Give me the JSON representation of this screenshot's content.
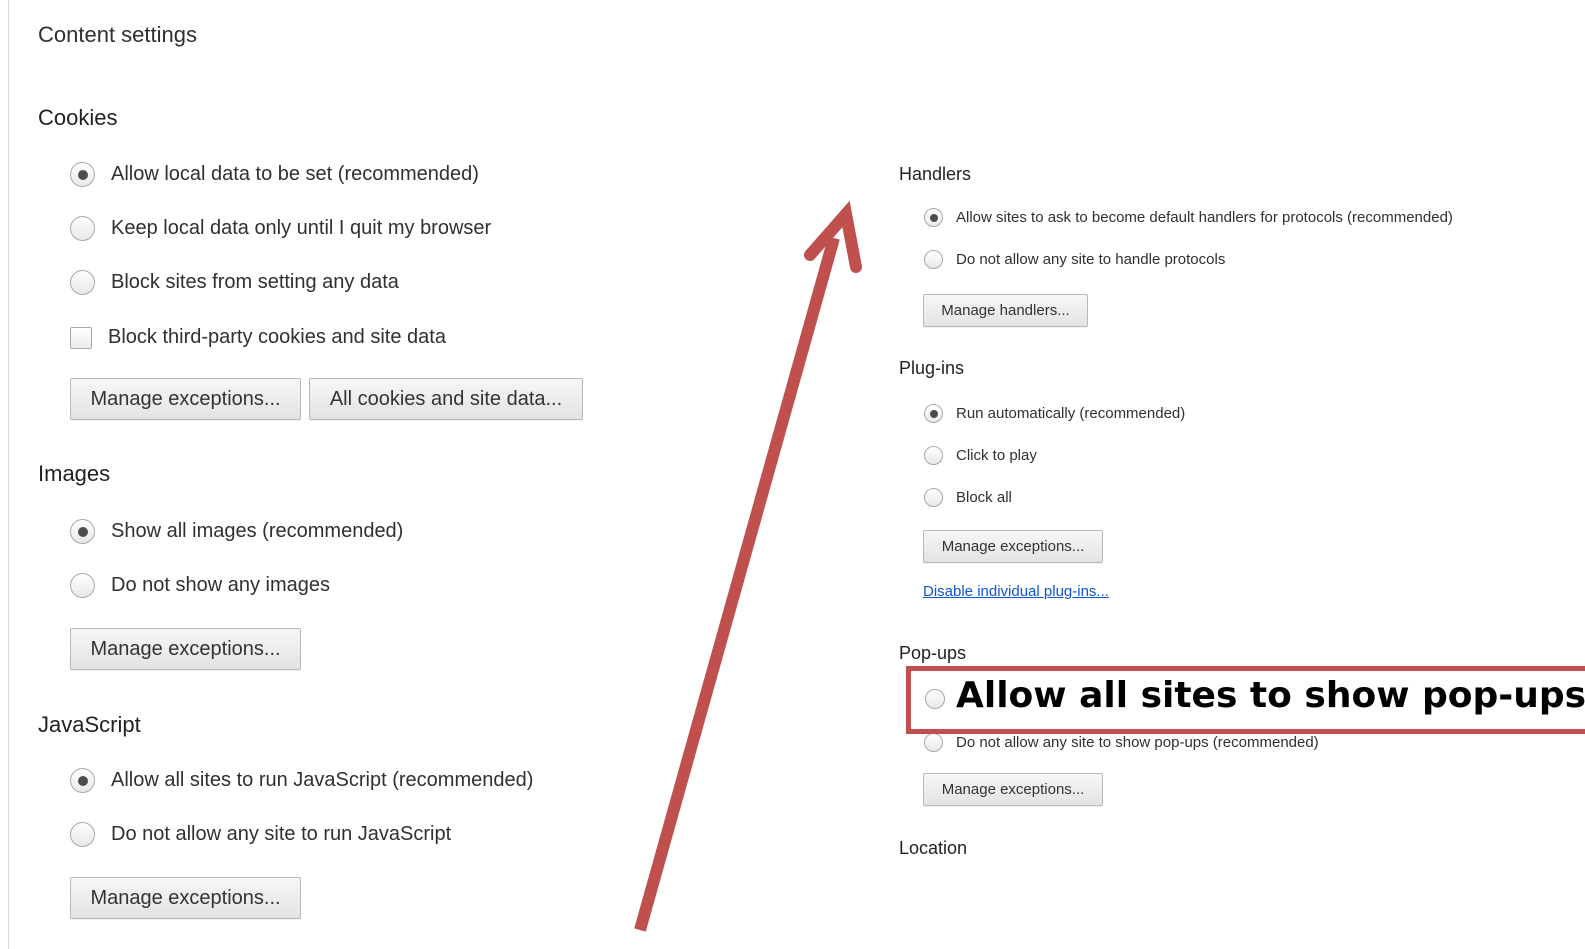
{
  "page": {
    "title": "Content settings"
  },
  "cookies": {
    "title": "Cookies",
    "options": [
      {
        "label": "Allow local data to be set (recommended)",
        "selected": true
      },
      {
        "label": "Keep local data only until I quit my browser",
        "selected": false
      },
      {
        "label": "Block sites from setting any data",
        "selected": false
      }
    ],
    "checkbox": {
      "label": "Block third-party cookies and site data",
      "checked": false
    },
    "buttons": {
      "manage_exceptions": "Manage exceptions...",
      "all_cookies": "All cookies and site data..."
    }
  },
  "images": {
    "title": "Images",
    "options": [
      {
        "label": "Show all images (recommended)",
        "selected": true
      },
      {
        "label": "Do not show any images",
        "selected": false
      }
    ],
    "buttons": {
      "manage_exceptions": "Manage exceptions..."
    }
  },
  "javascript": {
    "title": "JavaScript",
    "options": [
      {
        "label": "Allow all sites to run JavaScript (recommended)",
        "selected": true
      },
      {
        "label": "Do not allow any site to run JavaScript",
        "selected": false
      }
    ],
    "buttons": {
      "manage_exceptions": "Manage exceptions..."
    }
  },
  "handlers": {
    "title": "Handlers",
    "options": [
      {
        "label": "Allow sites to ask to become default handlers for protocols (recommended)",
        "selected": true
      },
      {
        "label": "Do not allow any site to handle protocols",
        "selected": false
      }
    ],
    "buttons": {
      "manage_handlers": "Manage handlers..."
    }
  },
  "plugins": {
    "title": "Plug-ins",
    "options": [
      {
        "label": "Run automatically (recommended)",
        "selected": true
      },
      {
        "label": "Click to play",
        "selected": false
      },
      {
        "label": "Block all",
        "selected": false
      }
    ],
    "buttons": {
      "manage_exceptions": "Manage exceptions..."
    },
    "link": "Disable individual plug-ins..."
  },
  "popups": {
    "title": "Pop-ups",
    "highlight_label": "Allow all sites to show pop-ups",
    "options": [
      {
        "label": "Do not allow any site to show pop-ups (recommended)",
        "selected": false
      }
    ],
    "buttons": {
      "manage_exceptions": "Manage exceptions..."
    }
  },
  "location": {
    "title": "Location"
  },
  "annotation": {
    "color": "#c0504d",
    "icon": "arrow-icon"
  }
}
